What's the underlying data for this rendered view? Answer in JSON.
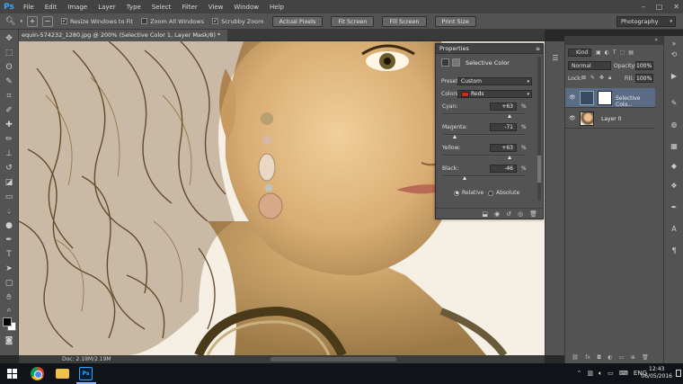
{
  "app": {
    "logo": "Ps",
    "menu": [
      "File",
      "Edit",
      "Image",
      "Layer",
      "Type",
      "Select",
      "Filter",
      "View",
      "Window",
      "Help"
    ],
    "window_controls": [
      "–",
      "□",
      "✕"
    ]
  },
  "options_bar": {
    "checkboxes": [
      {
        "label": "Resize Windows to Fit",
        "checked": true
      },
      {
        "label": "Zoom All Windows",
        "checked": false
      },
      {
        "label": "Scrubby Zoom",
        "checked": true
      }
    ],
    "buttons": [
      "Actual Pixels",
      "Fit Screen",
      "Fill Screen",
      "Print Size"
    ],
    "workspace": "Photography"
  },
  "document": {
    "tab_title": "equin-574232_1280.jpg @ 200% (Selective Color 1, Layer Mask/8) *",
    "status": "Doc: 2.19M/2.19M"
  },
  "properties": {
    "title": "Properties",
    "adjustment": "Selective Color",
    "preset_label": "Preset:",
    "preset_value": "Custom",
    "colors_label": "Colors:",
    "colors_value": "Reds",
    "colors_swatch": "#d12a1a",
    "sliders": [
      {
        "label": "Cyan:",
        "value": "+63",
        "unit": "%",
        "fraction": 0.815
      },
      {
        "label": "Magenta:",
        "value": "-71",
        "unit": "%",
        "fraction": 0.145
      },
      {
        "label": "Yellow:",
        "value": "+63",
        "unit": "%",
        "fraction": 0.815
      },
      {
        "label": "Black:",
        "value": "-46",
        "unit": "%",
        "fraction": 0.27
      }
    ],
    "method_options": [
      {
        "label": "Relative",
        "selected": true
      },
      {
        "label": "Absolute",
        "selected": false
      }
    ]
  },
  "layers": {
    "filter_kind": "Kind",
    "blend_mode": "Normal",
    "opacity_label": "Opacity:",
    "opacity": "100%",
    "lock_label": "Lock:",
    "fill_label": "Fill:",
    "fill": "100%",
    "items": [
      {
        "name": "Selective Colo...",
        "selected": true,
        "visible": true
      },
      {
        "name": "Layer 0",
        "selected": false,
        "visible": true
      }
    ]
  },
  "taskbar": {
    "tray_lang": "ENG",
    "time": "12:43",
    "date": "06/05/2016"
  }
}
